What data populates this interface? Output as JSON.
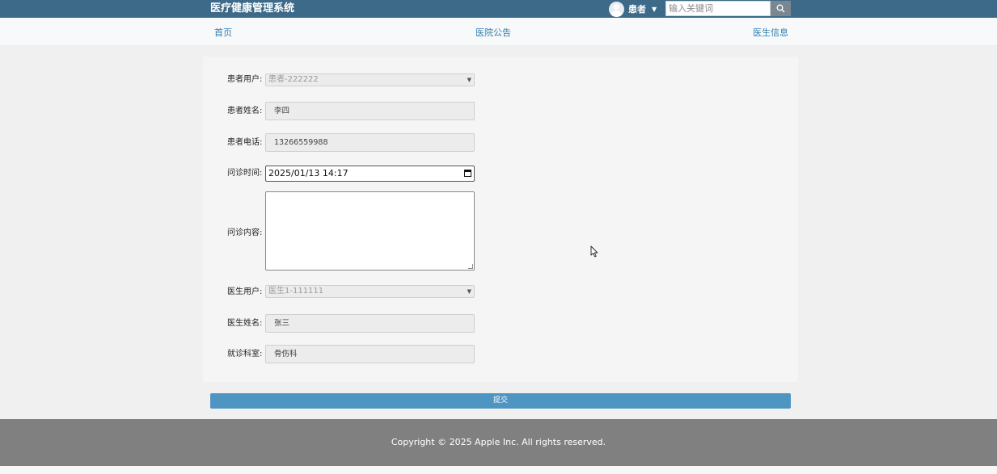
{
  "header": {
    "brand": "医疗健康管理系统",
    "user_name": "患者",
    "caret": "▼",
    "search_placeholder": "输入关键词"
  },
  "nav": {
    "items": [
      {
        "label": "首页"
      },
      {
        "label": "医院公告"
      },
      {
        "label": "医生信息"
      }
    ]
  },
  "form": {
    "patient_user": {
      "label": "患者用户:",
      "value": "患者-222222"
    },
    "patient_name": {
      "label": "患者姓名:",
      "value": "李四"
    },
    "patient_phone": {
      "label": "患者电话:",
      "value": "13266559988"
    },
    "visit_time": {
      "label": "问诊时间:",
      "value": "2025/01/13 14:17"
    },
    "visit_content": {
      "label": "问诊内容:",
      "value": ""
    },
    "doctor_user": {
      "label": "医生用户:",
      "value": "医生1-111111"
    },
    "doctor_name": {
      "label": "医生姓名:",
      "value": "张三"
    },
    "department": {
      "label": "就诊科室:",
      "value": "骨伤科"
    },
    "submit_label": "提交"
  },
  "footer": {
    "copyright": "Copyright © 2025 Apple Inc. All rights reserved."
  },
  "icons": {
    "avatar": "avatar-icon",
    "search": "search-icon",
    "calendar": "calendar-icon",
    "select_arrow": "chevron-down-icon",
    "cursor": "mouse-pointer-icon"
  },
  "colors": {
    "topbar": "#3d6a88",
    "nav_link": "#2f7fae",
    "submit": "#4f95c2",
    "footer": "#808080"
  }
}
